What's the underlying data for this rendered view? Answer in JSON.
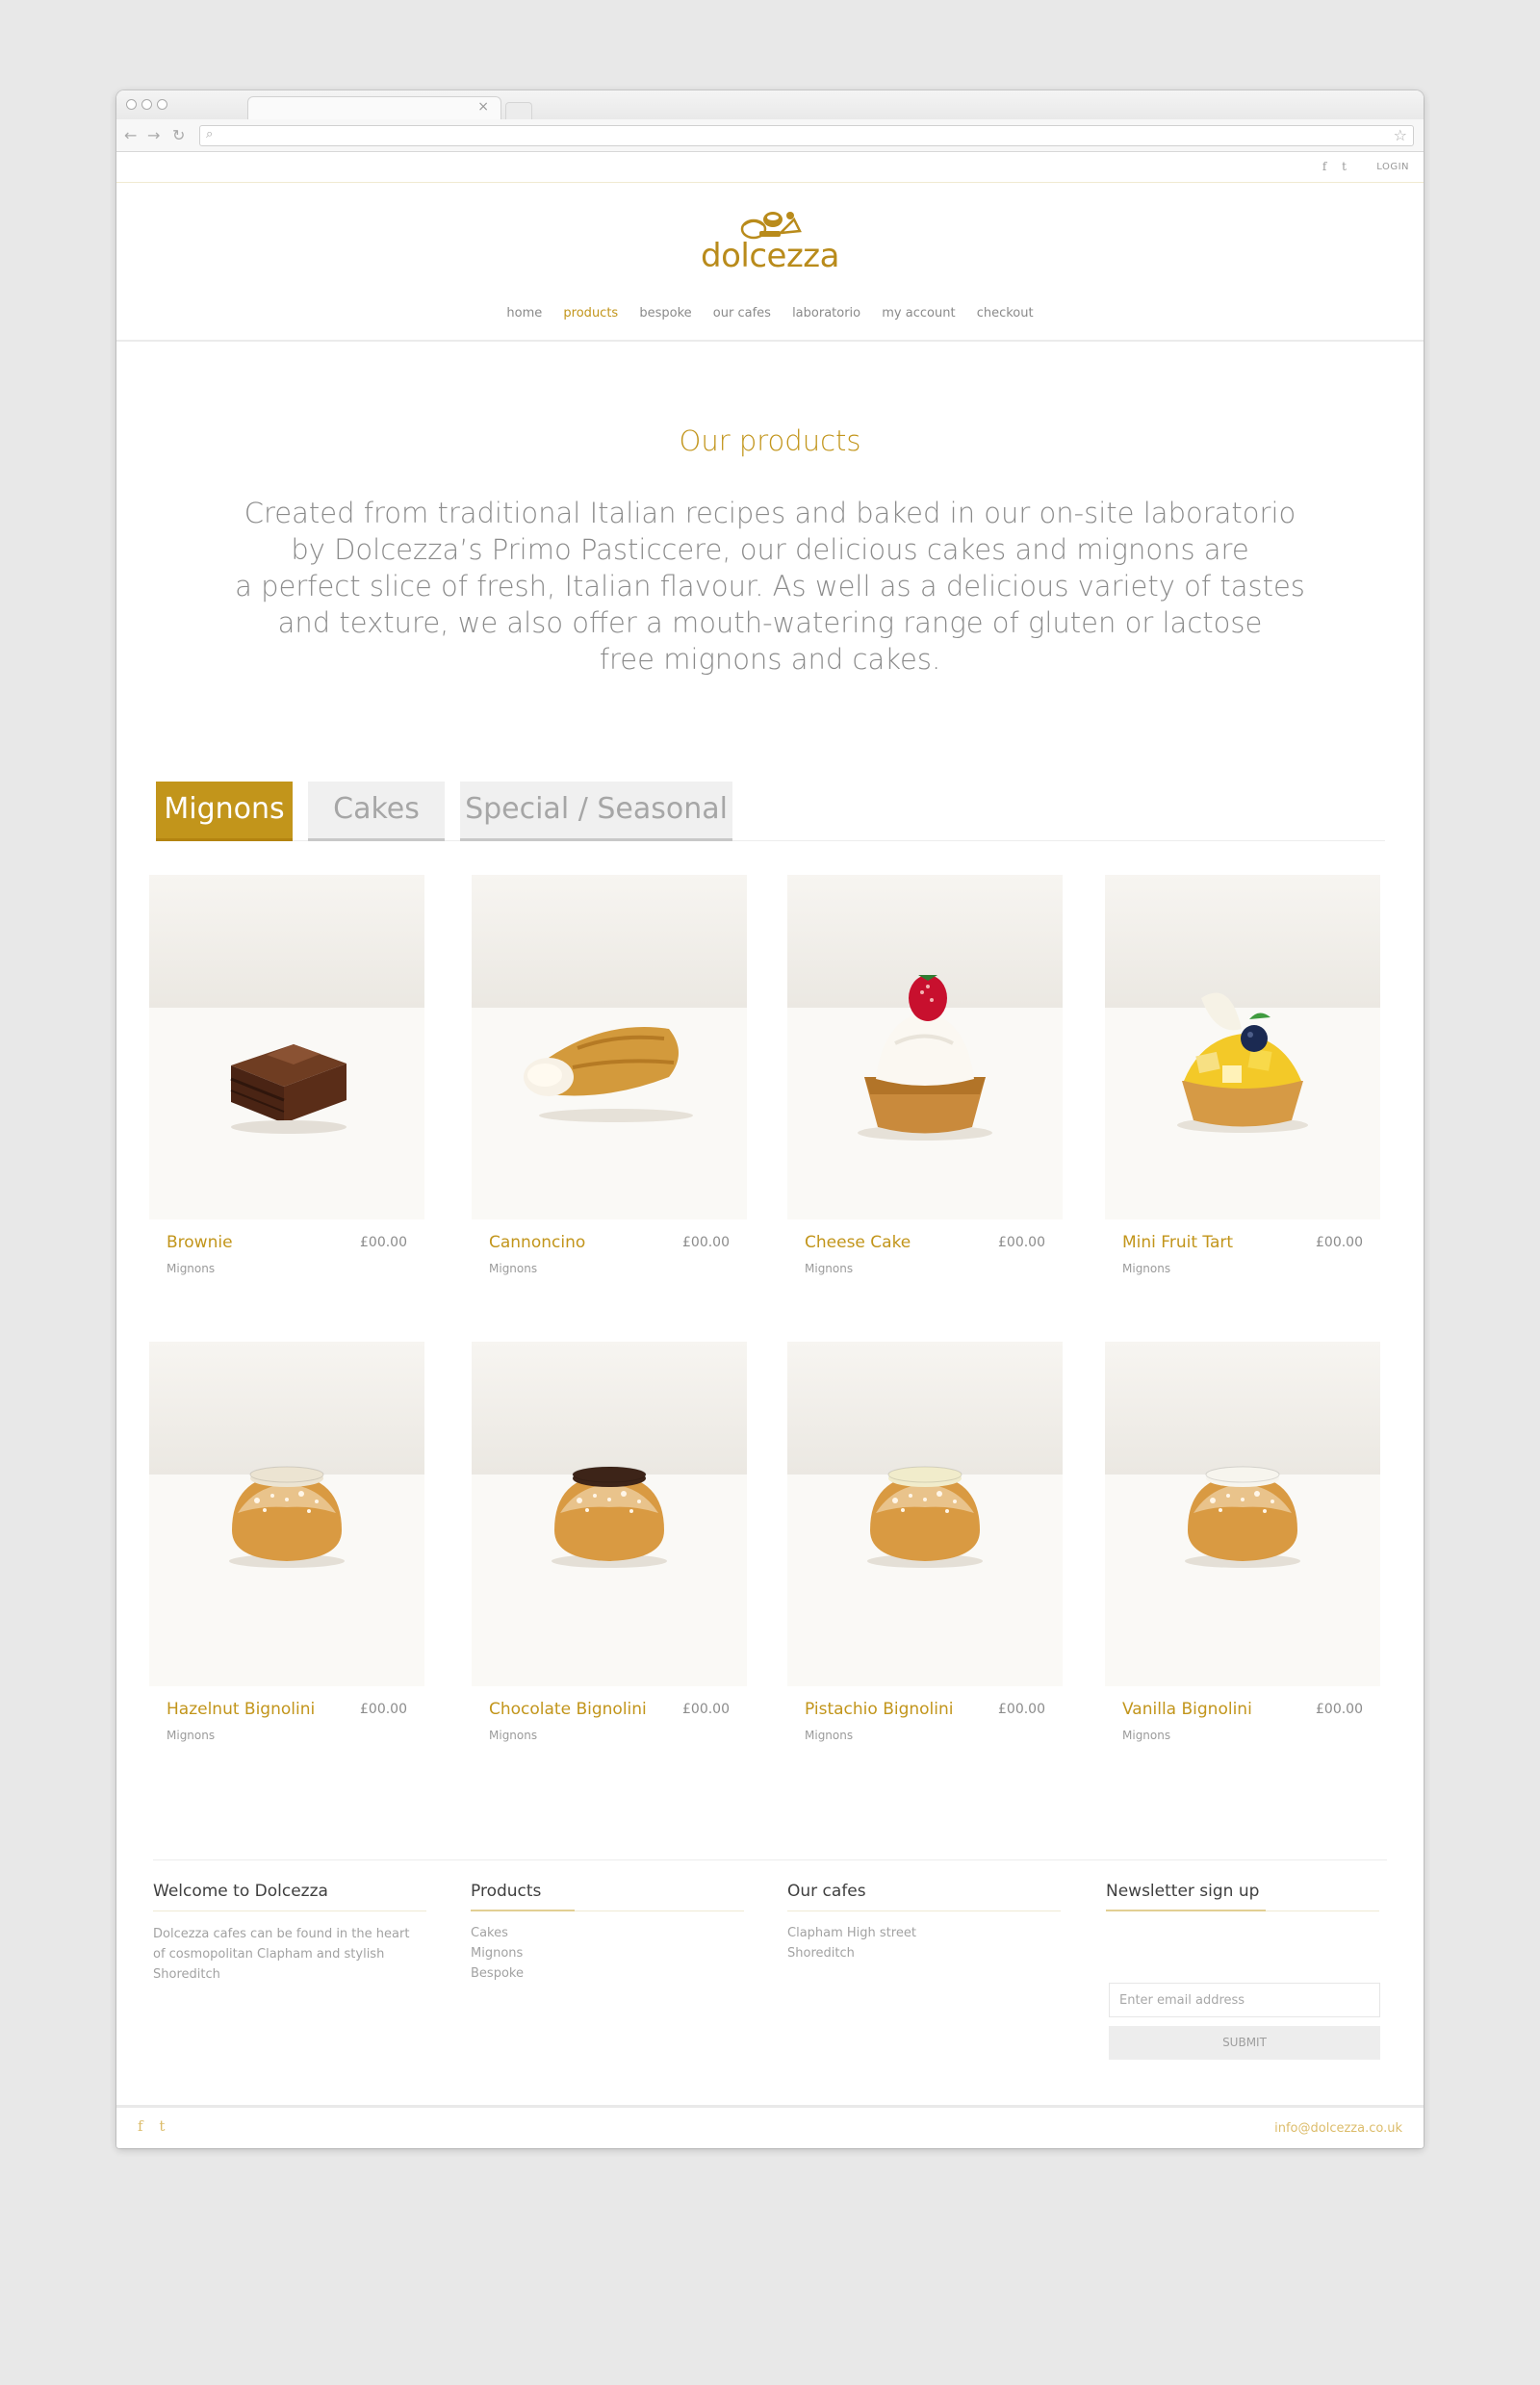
{
  "browser": {
    "tab_close": "×",
    "search_glyph": "⌕",
    "back_glyph": "←",
    "forward_glyph": "→",
    "reload_glyph": "↻",
    "star_glyph": "☆"
  },
  "topbar": {
    "facebook": "f",
    "twitter": "t",
    "login": "LOGIN"
  },
  "logo": {
    "text": "dolcezza"
  },
  "nav": [
    {
      "label": "home",
      "active": false
    },
    {
      "label": "products",
      "active": true
    },
    {
      "label": "bespoke",
      "active": false
    },
    {
      "label": "our cafes",
      "active": false
    },
    {
      "label": "laboratorio",
      "active": false
    },
    {
      "label": "my account",
      "active": false
    },
    {
      "label": "checkout",
      "active": false
    }
  ],
  "page": {
    "title": "Our products",
    "intro_lines": [
      "Created from traditional Italian recipes and baked in our on-site laboratorio",
      "by Dolcezza’s Primo Pasticcere, our delicious cakes and mignons are",
      "a perfect slice of fresh, Italian flavour. As well as a delicious variety of tastes",
      "and texture, we also offer a mouth-watering range of gluten or lactose",
      "free mignons and cakes."
    ]
  },
  "tabs": [
    {
      "label": "Mignons",
      "active": true
    },
    {
      "label": "Cakes",
      "active": false
    },
    {
      "label": "Special / Seasonal",
      "active": false
    }
  ],
  "products": [
    {
      "name": "Brownie",
      "price": "£00.00",
      "category": "Mignons",
      "icon": "brownie-image"
    },
    {
      "name": "Cannoncino",
      "price": "£00.00",
      "category": "Mignons",
      "icon": "cannoncino-image"
    },
    {
      "name": "Cheese Cake",
      "price": "£00.00",
      "category": "Mignons",
      "icon": "cheesecake-image"
    },
    {
      "name": "Mini Fruit Tart",
      "price": "£00.00",
      "category": "Mignons",
      "icon": "fruit-tart-image"
    },
    {
      "name": "Hazelnut Bignolini",
      "price": "£00.00",
      "category": "Mignons",
      "icon": "bignolini-image",
      "top_color": "#ece4d2"
    },
    {
      "name": "Chocolate Bignolini",
      "price": "£00.00",
      "category": "Mignons",
      "icon": "bignolini-image",
      "top_color": "#3d2418"
    },
    {
      "name": "Pistachio Bignolini",
      "price": "£00.00",
      "category": "Mignons",
      "icon": "bignolini-image",
      "top_color": "#f1eccb"
    },
    {
      "name": "Vanilla Bignolini",
      "price": "£00.00",
      "category": "Mignons",
      "icon": "bignolini-image",
      "top_color": "#f7f5ee"
    }
  ],
  "footer": {
    "welcome": {
      "title": "Welcome to Dolcezza",
      "lines": [
        "Dolcezza cafes can be found in the heart",
        "of cosmopolitan Clapham and stylish",
        "Shoreditch"
      ]
    },
    "products": {
      "title": "Products",
      "items": [
        "Cakes",
        "Mignons",
        "Bespoke"
      ]
    },
    "cafes": {
      "title": "Our cafes",
      "items": [
        "Clapham High street",
        "Shoreditch"
      ]
    },
    "newsletter": {
      "title": "Newsletter sign up",
      "placeholder": "Enter email address",
      "submit": "SUBMIT"
    },
    "email": "info@dolcezza.co.uk",
    "facebook": "f",
    "twitter": "t"
  },
  "colors": {
    "accent": "#c2951b",
    "text_grey": "#8b8b8b",
    "background": "#e8e8e8"
  }
}
